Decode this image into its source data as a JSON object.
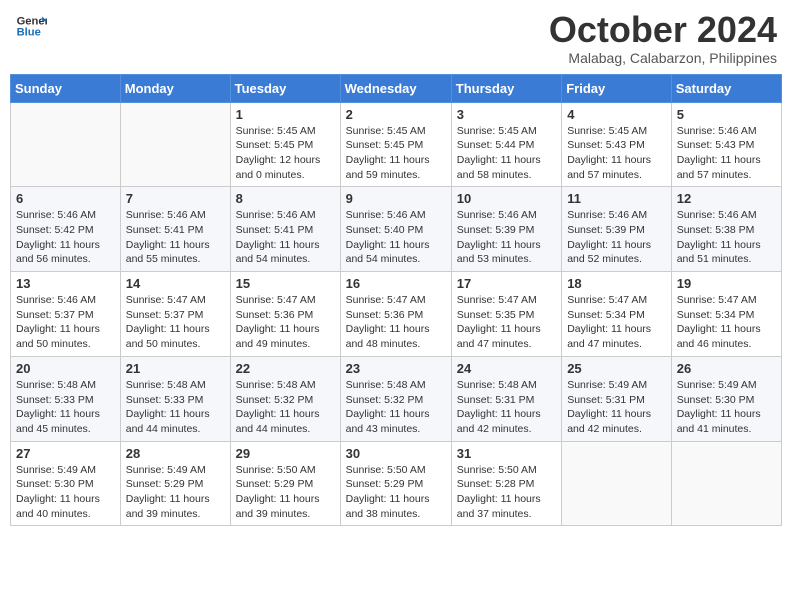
{
  "header": {
    "logo_line1": "General",
    "logo_line2": "Blue",
    "month_title": "October 2024",
    "subtitle": "Malabag, Calabarzon, Philippines"
  },
  "weekdays": [
    "Sunday",
    "Monday",
    "Tuesday",
    "Wednesday",
    "Thursday",
    "Friday",
    "Saturday"
  ],
  "weeks": [
    [
      {
        "day": "",
        "info": ""
      },
      {
        "day": "",
        "info": ""
      },
      {
        "day": "1",
        "info": "Sunrise: 5:45 AM\nSunset: 5:45 PM\nDaylight: 12 hours\nand 0 minutes."
      },
      {
        "day": "2",
        "info": "Sunrise: 5:45 AM\nSunset: 5:45 PM\nDaylight: 11 hours\nand 59 minutes."
      },
      {
        "day": "3",
        "info": "Sunrise: 5:45 AM\nSunset: 5:44 PM\nDaylight: 11 hours\nand 58 minutes."
      },
      {
        "day": "4",
        "info": "Sunrise: 5:45 AM\nSunset: 5:43 PM\nDaylight: 11 hours\nand 57 minutes."
      },
      {
        "day": "5",
        "info": "Sunrise: 5:46 AM\nSunset: 5:43 PM\nDaylight: 11 hours\nand 57 minutes."
      }
    ],
    [
      {
        "day": "6",
        "info": "Sunrise: 5:46 AM\nSunset: 5:42 PM\nDaylight: 11 hours\nand 56 minutes."
      },
      {
        "day": "7",
        "info": "Sunrise: 5:46 AM\nSunset: 5:41 PM\nDaylight: 11 hours\nand 55 minutes."
      },
      {
        "day": "8",
        "info": "Sunrise: 5:46 AM\nSunset: 5:41 PM\nDaylight: 11 hours\nand 54 minutes."
      },
      {
        "day": "9",
        "info": "Sunrise: 5:46 AM\nSunset: 5:40 PM\nDaylight: 11 hours\nand 54 minutes."
      },
      {
        "day": "10",
        "info": "Sunrise: 5:46 AM\nSunset: 5:39 PM\nDaylight: 11 hours\nand 53 minutes."
      },
      {
        "day": "11",
        "info": "Sunrise: 5:46 AM\nSunset: 5:39 PM\nDaylight: 11 hours\nand 52 minutes."
      },
      {
        "day": "12",
        "info": "Sunrise: 5:46 AM\nSunset: 5:38 PM\nDaylight: 11 hours\nand 51 minutes."
      }
    ],
    [
      {
        "day": "13",
        "info": "Sunrise: 5:46 AM\nSunset: 5:37 PM\nDaylight: 11 hours\nand 50 minutes."
      },
      {
        "day": "14",
        "info": "Sunrise: 5:47 AM\nSunset: 5:37 PM\nDaylight: 11 hours\nand 50 minutes."
      },
      {
        "day": "15",
        "info": "Sunrise: 5:47 AM\nSunset: 5:36 PM\nDaylight: 11 hours\nand 49 minutes."
      },
      {
        "day": "16",
        "info": "Sunrise: 5:47 AM\nSunset: 5:36 PM\nDaylight: 11 hours\nand 48 minutes."
      },
      {
        "day": "17",
        "info": "Sunrise: 5:47 AM\nSunset: 5:35 PM\nDaylight: 11 hours\nand 47 minutes."
      },
      {
        "day": "18",
        "info": "Sunrise: 5:47 AM\nSunset: 5:34 PM\nDaylight: 11 hours\nand 47 minutes."
      },
      {
        "day": "19",
        "info": "Sunrise: 5:47 AM\nSunset: 5:34 PM\nDaylight: 11 hours\nand 46 minutes."
      }
    ],
    [
      {
        "day": "20",
        "info": "Sunrise: 5:48 AM\nSunset: 5:33 PM\nDaylight: 11 hours\nand 45 minutes."
      },
      {
        "day": "21",
        "info": "Sunrise: 5:48 AM\nSunset: 5:33 PM\nDaylight: 11 hours\nand 44 minutes."
      },
      {
        "day": "22",
        "info": "Sunrise: 5:48 AM\nSunset: 5:32 PM\nDaylight: 11 hours\nand 44 minutes."
      },
      {
        "day": "23",
        "info": "Sunrise: 5:48 AM\nSunset: 5:32 PM\nDaylight: 11 hours\nand 43 minutes."
      },
      {
        "day": "24",
        "info": "Sunrise: 5:48 AM\nSunset: 5:31 PM\nDaylight: 11 hours\nand 42 minutes."
      },
      {
        "day": "25",
        "info": "Sunrise: 5:49 AM\nSunset: 5:31 PM\nDaylight: 11 hours\nand 42 minutes."
      },
      {
        "day": "26",
        "info": "Sunrise: 5:49 AM\nSunset: 5:30 PM\nDaylight: 11 hours\nand 41 minutes."
      }
    ],
    [
      {
        "day": "27",
        "info": "Sunrise: 5:49 AM\nSunset: 5:30 PM\nDaylight: 11 hours\nand 40 minutes."
      },
      {
        "day": "28",
        "info": "Sunrise: 5:49 AM\nSunset: 5:29 PM\nDaylight: 11 hours\nand 39 minutes."
      },
      {
        "day": "29",
        "info": "Sunrise: 5:50 AM\nSunset: 5:29 PM\nDaylight: 11 hours\nand 39 minutes."
      },
      {
        "day": "30",
        "info": "Sunrise: 5:50 AM\nSunset: 5:29 PM\nDaylight: 11 hours\nand 38 minutes."
      },
      {
        "day": "31",
        "info": "Sunrise: 5:50 AM\nSunset: 5:28 PM\nDaylight: 11 hours\nand 37 minutes."
      },
      {
        "day": "",
        "info": ""
      },
      {
        "day": "",
        "info": ""
      }
    ]
  ]
}
